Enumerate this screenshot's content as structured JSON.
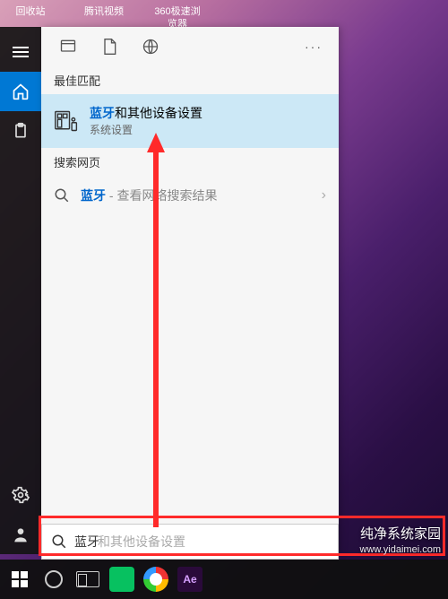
{
  "desktop": {
    "icons": [
      "回收站",
      "腾讯视频",
      "360极速浏览器"
    ]
  },
  "leftbar": {
    "items": [
      "menu",
      "home",
      "clipboard"
    ],
    "bottom": [
      "settings",
      "user"
    ]
  },
  "panel_top": {
    "filters": [
      "apps",
      "documents",
      "web"
    ],
    "more": "···"
  },
  "sections": {
    "best_match_label": "最佳匹配",
    "web_label": "搜索网页"
  },
  "best_match": {
    "highlight": "蓝牙",
    "rest": "和其他设备设置",
    "subtitle": "系统设置"
  },
  "web_result": {
    "highlight": "蓝牙",
    "suffix": " - 查看网络搜索结果"
  },
  "search": {
    "value": "蓝牙",
    "ghost": "和其他设备设置"
  },
  "taskbar": {
    "ae": "Ae"
  },
  "watermark": {
    "title": "纯净系统家园",
    "url": "www.yidaimei.com"
  }
}
